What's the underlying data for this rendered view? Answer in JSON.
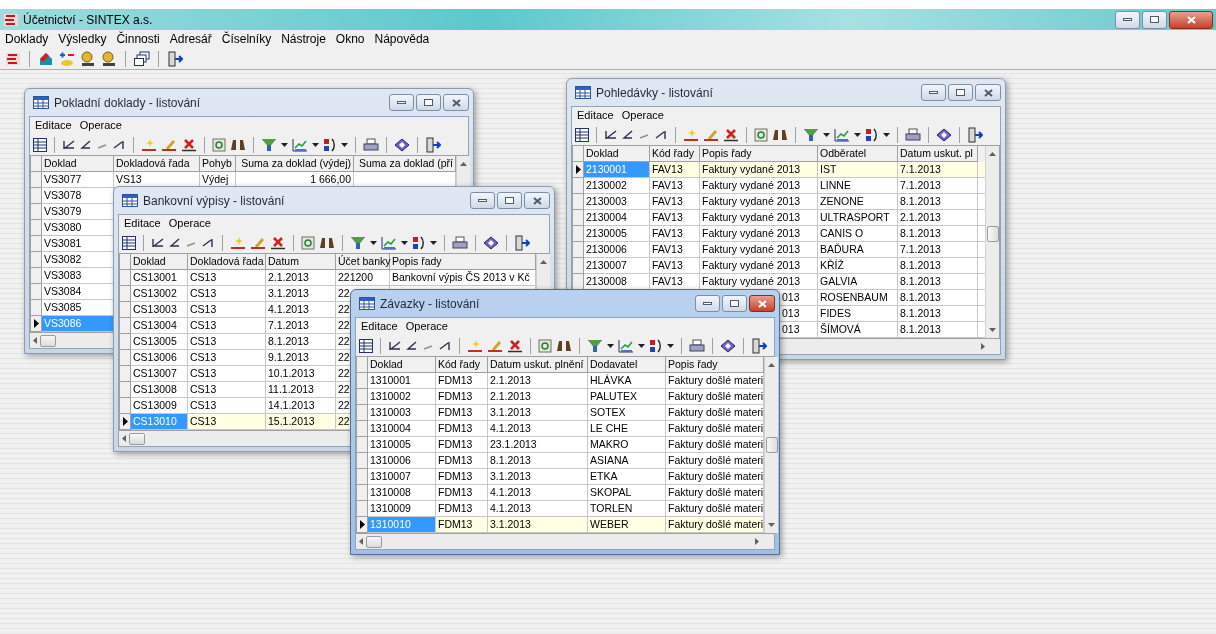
{
  "app": {
    "title": "Účetnictví - SINTEX a.s.",
    "menu": [
      "Doklady",
      "Výsledky",
      "Činnosti",
      "Adresář",
      "Číselníky",
      "Nástroje",
      "Okno",
      "Nápověda"
    ]
  },
  "windows": [
    {
      "title": "Pokladní doklady - listování",
      "active": false,
      "menu": [
        "Editace",
        "Operace"
      ],
      "columns": [
        {
          "label": "Doklad",
          "numeric": false
        },
        {
          "label": "Dokladová řada",
          "numeric": false
        },
        {
          "label": "Pohyb",
          "numeric": false
        },
        {
          "label": "Suma za doklad (výdej)",
          "numeric": true
        },
        {
          "label": "Suma za doklad (pří",
          "numeric": true
        }
      ],
      "rows": [
        {
          "cells": [
            "VS3077",
            "VS13",
            "Výdej",
            "1 666,00",
            null
          ],
          "selected": false
        },
        {
          "cells": [
            "VS3078"
          ],
          "selected": false
        },
        {
          "cells": [
            "VS3079"
          ],
          "selected": false
        },
        {
          "cells": [
            "VS3080"
          ],
          "selected": false
        },
        {
          "cells": [
            "VS3081"
          ],
          "selected": false
        },
        {
          "cells": [
            "VS3082"
          ],
          "selected": false
        },
        {
          "cells": [
            "VS3083"
          ],
          "selected": false
        },
        {
          "cells": [
            "VS3084"
          ],
          "selected": false
        },
        {
          "cells": [
            "VS3085"
          ],
          "selected": false
        },
        {
          "cells": [
            "VS3086"
          ],
          "selected": true
        }
      ]
    },
    {
      "title": "Pohledávky - listování",
      "active": false,
      "menu": [
        "Editace",
        "Operace"
      ],
      "columns": [
        {
          "label": "Doklad"
        },
        {
          "label": "Kód řady"
        },
        {
          "label": "Popis řady"
        },
        {
          "label": "Odběratel"
        },
        {
          "label": "Datum uskut. pl"
        }
      ],
      "rows": [
        {
          "cells": [
            "2130001",
            "FAV13",
            "Faktury vydané 2013",
            "IST",
            "7.1.2013"
          ],
          "selected": true
        },
        {
          "cells": [
            "2130002",
            "FAV13",
            "Faktury vydané 2013",
            "LINNE",
            "7.1.2013"
          ],
          "selected": false
        },
        {
          "cells": [
            "2130003",
            "FAV13",
            "Faktury vydané 2013",
            "ZENONE",
            "8.1.2013"
          ],
          "selected": false
        },
        {
          "cells": [
            "2130004",
            "FAV13",
            "Faktury vydané 2013",
            "ULTRASPORT",
            "2.1.2013"
          ],
          "selected": false
        },
        {
          "cells": [
            "2130005",
            "FAV13",
            "Faktury vydané 2013",
            "CANIS O",
            "8.1.2013"
          ],
          "selected": false
        },
        {
          "cells": [
            "2130006",
            "FAV13",
            "Faktury vydané 2013",
            "BAĎURA",
            "7.1.2013"
          ],
          "selected": false
        },
        {
          "cells": [
            "2130007",
            "FAV13",
            "Faktury vydané 2013",
            "KŘÍŽ",
            "8.1.2013"
          ],
          "selected": false
        },
        {
          "cells": [
            "2130008",
            "FAV13",
            "Faktury vydané 2013",
            "GALVIA",
            "8.1.2013"
          ],
          "selected": false
        },
        {
          "cells": [
            null,
            null,
            {
              "text": "013",
              "tail": true
            },
            "ROSENBAUM",
            "8.1.2013"
          ],
          "selected": false
        },
        {
          "cells": [
            null,
            null,
            {
              "text": "013",
              "tail": true
            },
            "FIDES",
            "8.1.2013"
          ],
          "selected": false
        },
        {
          "cells": [
            null,
            null,
            {
              "text": "013",
              "tail": true
            },
            "ŠÍMOVÁ",
            "8.1.2013"
          ],
          "selected": false
        }
      ]
    },
    {
      "title": "Bankovní výpisy - listování",
      "active": false,
      "menu": [
        "Editace",
        "Operace"
      ],
      "columns": [
        {
          "label": "Doklad"
        },
        {
          "label": "Dokladová řada"
        },
        {
          "label": "Datum"
        },
        {
          "label": "Účet banky"
        },
        {
          "label": "Popis řady"
        }
      ],
      "rows": [
        {
          "cells": [
            "CS13001",
            "CS13",
            "2.1.2013",
            "221200",
            "Bankovní výpis ČS 2013 v Kč"
          ],
          "selected": false
        },
        {
          "cells": [
            "CS13002",
            "CS13",
            "3.1.2013",
            "22"
          ],
          "selected": false
        },
        {
          "cells": [
            "CS13003",
            "CS13",
            "4.1.2013",
            "22"
          ],
          "selected": false
        },
        {
          "cells": [
            "CS13004",
            "CS13",
            "7.1.2013",
            "22"
          ],
          "selected": false
        },
        {
          "cells": [
            "CS13005",
            "CS13",
            "8.1.2013",
            "22"
          ],
          "selected": false
        },
        {
          "cells": [
            "CS13006",
            "CS13",
            "9.1.2013",
            "22"
          ],
          "selected": false
        },
        {
          "cells": [
            "CS13007",
            "CS13",
            "10.1.2013",
            "22"
          ],
          "selected": false
        },
        {
          "cells": [
            "CS13008",
            "CS13",
            "11.1.2013",
            "22"
          ],
          "selected": false
        },
        {
          "cells": [
            "CS13009",
            "CS13",
            "14.1.2013",
            "22"
          ],
          "selected": false
        },
        {
          "cells": [
            "CS13010",
            "CS13",
            "15.1.2013",
            "22"
          ],
          "selected": true
        }
      ]
    },
    {
      "title": "Závazky - listování",
      "active": true,
      "menu": [
        "Editace",
        "Operace"
      ],
      "columns": [
        {
          "label": "Doklad"
        },
        {
          "label": "Kód řady"
        },
        {
          "label": "Datum uskut. plnění"
        },
        {
          "label": "Dodavatel"
        },
        {
          "label": "Popis řady"
        }
      ],
      "rows": [
        {
          "cells": [
            "1310001",
            "FDM13",
            "2.1.2013",
            "HLÁVKA",
            "Faktury došlé materi"
          ],
          "selected": false
        },
        {
          "cells": [
            "1310002",
            "FDM13",
            "2.1.2013",
            "PALUTEX",
            "Faktury došlé materi"
          ],
          "selected": false
        },
        {
          "cells": [
            "1310003",
            "FDM13",
            "3.1.2013",
            "SOTEX",
            "Faktury došlé materi"
          ],
          "selected": false
        },
        {
          "cells": [
            "1310004",
            "FDM13",
            "4.1.2013",
            "LE CHE",
            "Faktury došlé materi"
          ],
          "selected": false
        },
        {
          "cells": [
            "1310005",
            "FDM13",
            "23.1.2013",
            "MAKRO",
            "Faktury došlé materi"
          ],
          "selected": false
        },
        {
          "cells": [
            "1310006",
            "FDM13",
            "8.1.2013",
            "ASIANA",
            "Faktury došlé materi"
          ],
          "selected": false
        },
        {
          "cells": [
            "1310007",
            "FDM13",
            "3.1.2013",
            "ETKA",
            "Faktury došlé materi"
          ],
          "selected": false
        },
        {
          "cells": [
            "1310008",
            "FDM13",
            "4.1.2013",
            "SKOPAL",
            "Faktury došlé materi"
          ],
          "selected": false
        },
        {
          "cells": [
            "1310009",
            "FDM13",
            "4.1.2013",
            "TORLEN",
            "Faktury došlé materi"
          ],
          "selected": false
        },
        {
          "cells": [
            "1310010",
            "FDM13",
            "3.1.2013",
            "WEBER",
            "Faktury došlé materi"
          ],
          "selected": true
        }
      ]
    }
  ]
}
